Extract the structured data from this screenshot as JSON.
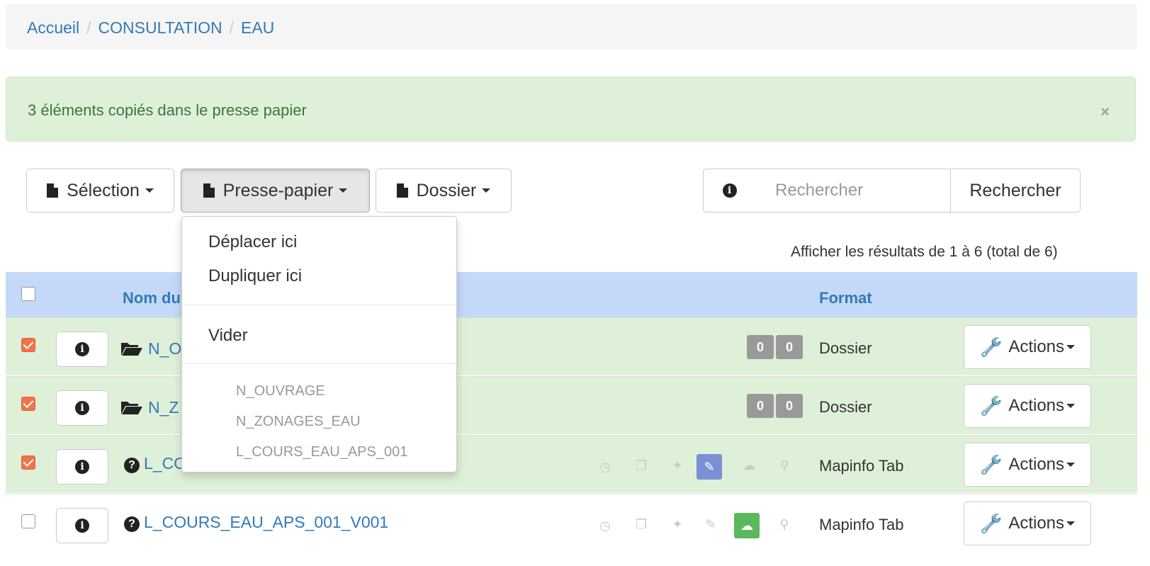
{
  "breadcrumb": {
    "items": [
      "Accueil",
      "CONSULTATION",
      "EAU"
    ],
    "sep": "/"
  },
  "alert": {
    "message": "3 éléments copiés dans le presse papier",
    "close": "×"
  },
  "toolbar": {
    "selection_label": "Sélection",
    "clipboard_label": "Presse-papier",
    "folder_label": "Dossier"
  },
  "search": {
    "placeholder": "Rechercher",
    "button_label": "Rechercher",
    "info_icon": "i"
  },
  "results": {
    "summary": "Afficher les résultats de 1 à 6 (total de 6)"
  },
  "table": {
    "columns": {
      "name": "Nom du",
      "format": "Format"
    },
    "rows": [
      {
        "name": "N_O",
        "checked": true,
        "type": "folder",
        "badge_a": "0",
        "badge_b": "0",
        "format": "Dossier",
        "actions": "Actions"
      },
      {
        "name": "N_Z",
        "checked": true,
        "type": "folder",
        "badge_a": "0",
        "badge_b": "0",
        "format": "Dossier",
        "actions": "Actions"
      },
      {
        "name": "L_CO",
        "checked": true,
        "type": "file",
        "format": "Mapinfo Tab",
        "actions": "Actions",
        "highlight": "feather"
      },
      {
        "name": "L_COURS_EAU_APS_001_V001",
        "checked": false,
        "type": "file",
        "format": "Mapinfo Tab",
        "actions": "Actions",
        "highlight": "cloud"
      }
    ]
  },
  "dropdown": {
    "items": [
      "Déplacer ici",
      "Dupliquer ici",
      "Vider"
    ],
    "clipboard_items": [
      "N_OUVRAGE",
      "N_ZONAGES_EAU",
      "L_COURS_EAU_APS_001"
    ]
  },
  "colors": {
    "link": "#337ab7",
    "success_bg": "#dff0d8",
    "header_bg": "#c4d9f7",
    "checkbox_checked": "#f0744a",
    "feather_box": "#7b8fd6",
    "cloud_box": "#5cb85c"
  }
}
